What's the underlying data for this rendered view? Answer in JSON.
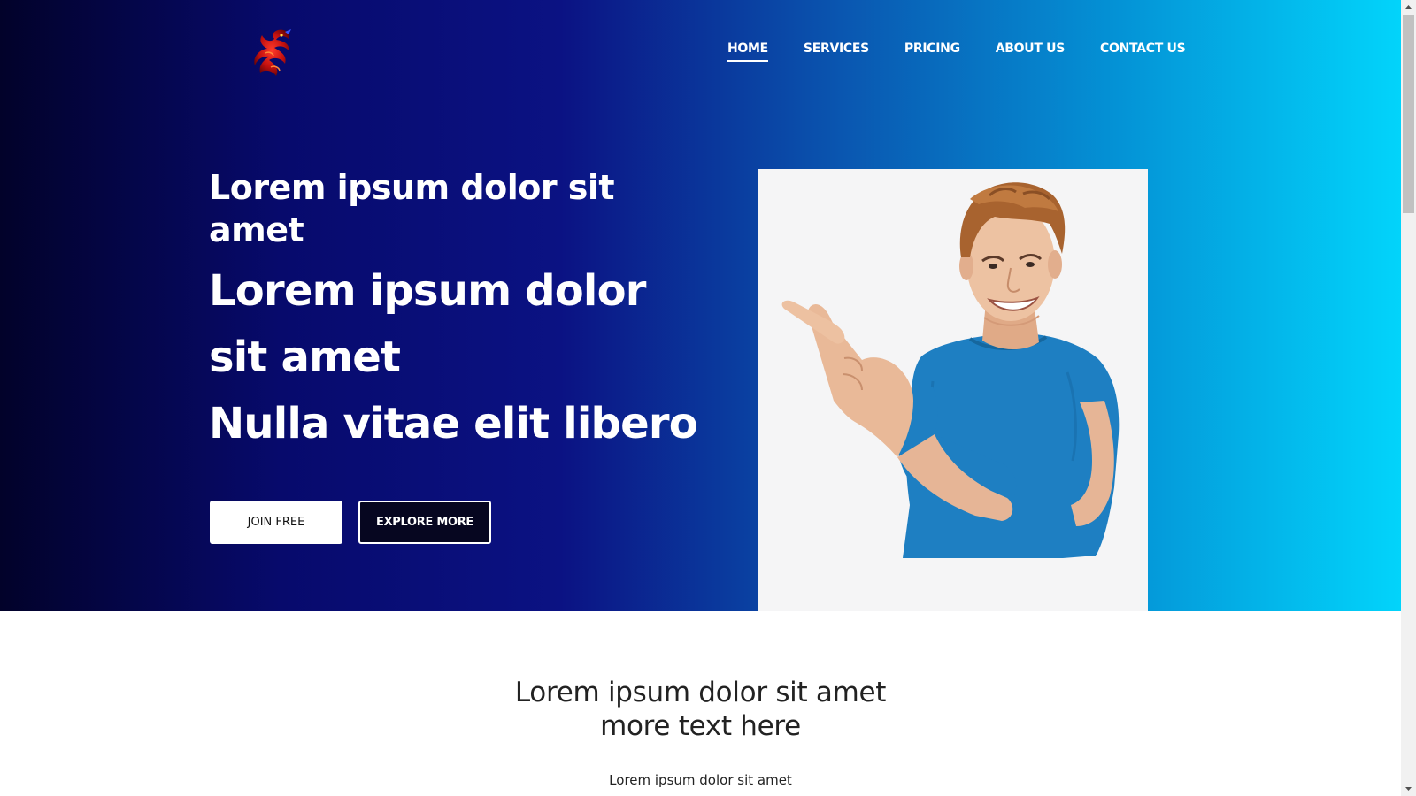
{
  "header": {
    "logo_icon": "red-dragon-logo-icon",
    "nav": [
      {
        "label": "HOME",
        "active": true
      },
      {
        "label": "SERVICES",
        "active": false
      },
      {
        "label": "PRICING",
        "active": false
      },
      {
        "label": "ABOUT US",
        "active": false
      },
      {
        "label": "CONTACT US",
        "active": false
      }
    ]
  },
  "hero": {
    "subtitle": "Lorem ipsum dolor sit amet",
    "title": "Lorem ipsum dolor sit amet",
    "title2": "Nulla vitae elit libero",
    "join_button": "JOIN FREE",
    "explore_button": "EXPLORE MORE",
    "image": "man-pointing-photo",
    "colors": {
      "gradient_start": "#02022a",
      "gradient_mid": "#0b1283",
      "gradient_end": "#02d4fb"
    }
  },
  "section": {
    "title_line1": "Lorem ipsum dolor sit amet",
    "title_line2": "more text here",
    "subtitle": "Lorem ipsum dolor sit amet"
  }
}
